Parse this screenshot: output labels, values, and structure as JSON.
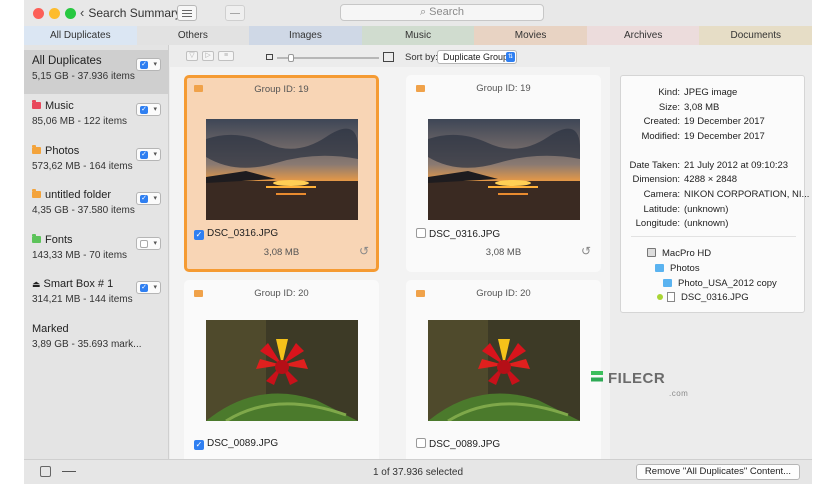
{
  "titlebar": {
    "back_label": "Search Summary",
    "search_placeholder": "Search"
  },
  "tabs": [
    {
      "label": "All Duplicates",
      "color": "#dbe6f3"
    },
    {
      "label": "Others",
      "color": "#e2e2e2"
    },
    {
      "label": "Images",
      "color": "#cfd8e6"
    },
    {
      "label": "Music",
      "color": "#d0dccf"
    },
    {
      "label": "Movies",
      "color": "#e8d3c3"
    },
    {
      "label": "Archives",
      "color": "#ecdcdc"
    },
    {
      "label": "Documents",
      "color": "#e6ddc6"
    }
  ],
  "sidebar": {
    "items": [
      {
        "name": "All Duplicates",
        "sub": "5,15 GB - 37.936 items",
        "checked": true,
        "color": ""
      },
      {
        "name": "Music",
        "sub": "85,06 MB - 122 items",
        "checked": true,
        "color": "#e8485c"
      },
      {
        "name": "Photos",
        "sub": "573,62 MB - 164 items",
        "checked": true,
        "color": "#f3a33b"
      },
      {
        "name": "untitled folder",
        "sub": "4,35 GB - 37.580 items",
        "checked": true,
        "color": "#f3a33b"
      },
      {
        "name": "Fonts",
        "sub": "143,33 MB - 70 items",
        "checked": false,
        "color": "#5cc35a"
      },
      {
        "name": "Smart Box # 1",
        "sub": "314,21 MB - 144 items",
        "checked": true,
        "color": ""
      },
      {
        "name": "Marked",
        "sub": "3,89 GB - 35.693 mark...",
        "checked": null,
        "color": ""
      }
    ]
  },
  "toolbar": {
    "sort_label": "Sort by:",
    "sort_value": "Duplicate Group"
  },
  "cards": [
    {
      "group": "Group ID: 19",
      "file": "DSC_0316.JPG",
      "size": "3,08 MB",
      "checked": true,
      "selected": true,
      "image": "sunset"
    },
    {
      "group": "Group ID: 19",
      "file": "DSC_0316.JPG",
      "size": "3,08 MB",
      "checked": false,
      "selected": false,
      "image": "sunset"
    },
    {
      "group": "Group ID: 20",
      "file": "DSC_0089.JPG",
      "size": "",
      "checked": true,
      "selected": false,
      "image": "flower"
    },
    {
      "group": "Group ID: 20",
      "file": "DSC_0089.JPG",
      "size": "",
      "checked": false,
      "selected": false,
      "image": "flower"
    }
  ],
  "detail": {
    "kind_k": "Kind:",
    "kind_v": "JPEG image",
    "size_k": "Size:",
    "size_v": "3,08 MB",
    "created_k": "Created:",
    "created_v": "19 December 2017",
    "modified_k": "Modified:",
    "modified_v": "19 December 2017",
    "taken_k": "Date Taken:",
    "taken_v": "21 July 2012 at 09:10:23",
    "dim_k": "Dimension:",
    "dim_v": "4288 × 2848",
    "cam_k": "Camera:",
    "cam_v": "NIKON CORPORATION, NI...",
    "lat_k": "Latitude:",
    "lat_v": "(unknown)",
    "lon_k": "Longitude:",
    "lon_v": "(unknown)",
    "path": [
      "MacPro HD",
      "Photos",
      "Photo_USA_2012 copy",
      "DSC_0316.JPG"
    ]
  },
  "status": {
    "text": "1 of 37.936 selected",
    "remove_label": "Remove \"All Duplicates\" Content..."
  },
  "watermark": {
    "text": "FILECR",
    "suffix": ".com"
  }
}
